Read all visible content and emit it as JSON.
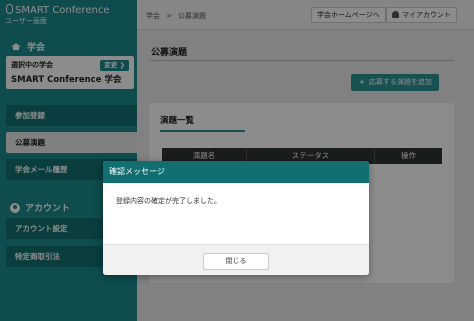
{
  "app": {
    "name": "SMART Conference",
    "subtitle": "ユーザー画面"
  },
  "sidebar": {
    "society_section": "学会",
    "society_selected_label": "選択中の学会",
    "society_change_label": "変更",
    "society_name": "SMART Conference 学会",
    "items": [
      {
        "label": "参加登録"
      },
      {
        "label": "公募演題",
        "active": true
      },
      {
        "label": "学会メール履歴"
      }
    ],
    "account_section": "アカウント",
    "account_items": [
      {
        "label": "アカウント設定"
      },
      {
        "label": "特定商取引法"
      }
    ]
  },
  "topbar": {
    "breadcrumb": [
      "学会",
      "公募演題"
    ],
    "separator": ">",
    "homepage_button": "学会ホームページへ",
    "mypage_button": "マイアカウント"
  },
  "main": {
    "title": "公募演題",
    "add_button": "応募する演題を追加",
    "add_icon": "+",
    "card_title": "演題一覧",
    "columns": [
      "演題名",
      "ステータス",
      "操作"
    ]
  },
  "dialog": {
    "title": "確認メッセージ",
    "message": "登録内容の確定が完了しました。",
    "close_button": "閉じる"
  },
  "colors": {
    "primary": "#1a8a8c",
    "dark": "#126f71",
    "table_header": "#2f3336"
  }
}
